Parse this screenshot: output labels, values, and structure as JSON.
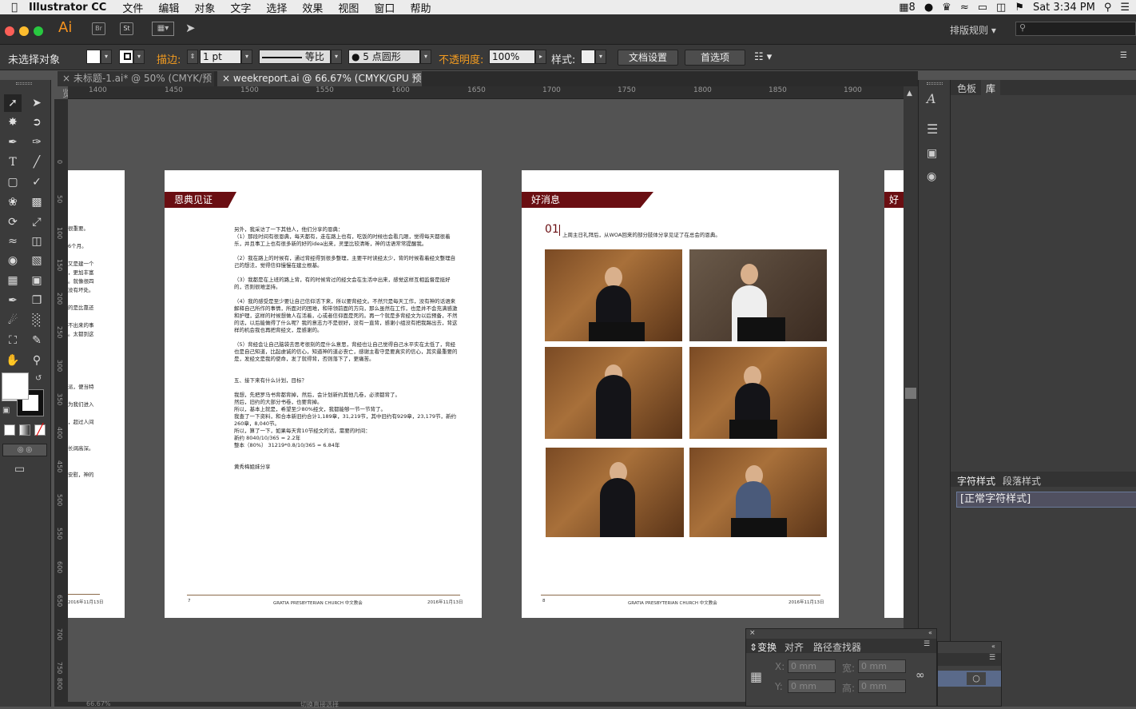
{
  "menubar": {
    "app_name": "Illustrator CC",
    "items": [
      "文件",
      "编辑",
      "对象",
      "文字",
      "选择",
      "效果",
      "视图",
      "窗口",
      "帮助"
    ],
    "status_num": "8",
    "clock": "Sat 3:34 PM"
  },
  "appbar": {
    "logo": "Ai",
    "br": "Br",
    "st": "St",
    "workspace": "排版规则",
    "search_placeholder": ""
  },
  "control": {
    "selection": "未选择对象",
    "stroke_label": "描边:",
    "stroke_value": "1 pt",
    "stroke_profile": "等比",
    "brush": "5 点圆形",
    "opacity_label": "不透明度:",
    "opacity_value": "100%",
    "style_label": "样式:",
    "doc_setup": "文档设置",
    "preferences": "首选项"
  },
  "tabs": [
    {
      "label": "未标题-1.ai* @ 50% (CMYK/预览)"
    },
    {
      "label": "weekreport.ai @ 66.67% (CMYK/GPU 预览)"
    }
  ],
  "ruler": {
    "h": [
      "1400",
      "1450",
      "1500",
      "1550",
      "1600",
      "1650",
      "1700",
      "1750",
      "1800",
      "1850",
      "1900"
    ],
    "v": [
      "0",
      "50",
      "100",
      "150",
      "200",
      "250",
      "300",
      "350",
      "400",
      "450",
      "500",
      "550",
      "600",
      "650",
      "700",
      "750",
      "800",
      "850"
    ]
  },
  "pages": {
    "left_partial": {
      "lines": [
        "很重要。",
        "",
        "6个月。",
        "",
        "又是建一个",
        "，更加丰富",
        "。就像很四",
        "没有坏处。",
        "",
        "的是比靠还",
        "",
        "不出来的事",
        "。太都到这",
        "",
        "",
        "",
        "",
        "",
        "派，便当特",
        "",
        "为我们进入",
        "",
        "，超过人间",
        "",
        "",
        "长阔高深。",
        "",
        "",
        "安慰，神的"
      ],
      "footer": "2016年11月13日"
    },
    "page7": {
      "title": "恩典见证",
      "body": "另外，我采访了一下其他人，他们分享的恩典：\n（1）那段时间有很恩典，每天都有，走在路上也有，吃饭的时候也会看几眼，觉得每天都很着乐，并且事工上也有很多新的好的idea出来，灵里比较清晰，神的话语常常提醒我。\n\n（2）我在路上的时候有，通过背经得到很多整理，主要平时读经太少，背的时候看着经文整理自己的想法，觉得信仰慢慢在建立根基。\n\n（3）我都是在上班的路上背，有的时候背过的经文会在生活中出来，感觉这样互相监督是挺好的，否则很难坚持。\n\n（4）我的感受是至少要让自己信仰活下来，所以要背经文。不然只是每天工作，没有神的话语来解释自己所作的事情，所面对的困难，和带领前面的方向，那么虽然在工作，也是并不会充满感激和护理，这样的时候想做人在活着，心或者信仰面是死的。再一个就是多背经文为以后预备，不然的话，以后能做得了什么呢？我的意志力不是很好，没有一直背，感谢小组没有把我踢出去，背这样的机会我也再把背经文，是感谢的。\n\n（5）背经会让自己脑袋去思考很刻的是什么意思，背经也让自己觉得自己水平实在太低了，背经也是自己知道，比起虔诚的信心，知道神的道必丧亡，感谢主看守是要真实的信心，其实最重要的是，发经文是我的使命，发了就得背，否则落下了，更痛苦。\n\n\n五、接下来有什么计划，目标？\n\n我想，先把罗马书背都背掉，然后，会计划新约其他几卷，必须都背了。\n然后，旧约的大部分书卷，也要背掉。\n所以，基本上就是，希望至少80%经文，我都能够一节一节背了。\n我查了一下资料，和合本新旧约合计1,189章，31,219节，其中旧约有929章，23,179节，新约260章，8,040节。\n所以，算了一下，如果每天背10节经文的话，需要的时间：\n新约 8040/10/365 = 2.2年\n整本（80%） 31219*0.8/10/365 = 6.84年\n\n\n黄秀梅姐妹分享",
      "page_no": "7",
      "church": "GRATIA PRESBYTERIAN CHURCH 中文教会",
      "date": "2016年11月13日"
    },
    "page8": {
      "title": "好消息",
      "num": "01",
      "headline": "上周主日礼拜后，从WOA回来的部分肢体分享见证了在总会的恩典。",
      "page_no": "8",
      "church": "GRATIA PRESBYTERIAN CHURCH 中文教会",
      "date": "2016年11月13日"
    },
    "right_partial": {
      "title": "好"
    }
  },
  "right_panel": {
    "tab1": "色板",
    "tab2": "库",
    "char_style_tab": "字符样式",
    "para_style_tab": "段落样式",
    "normal_style": "[正常字符样式]"
  },
  "transform_panel": {
    "tab1": "变换",
    "tab2": "对齐",
    "tab3": "路径查找器",
    "x_label": "X:",
    "y_label": "Y:",
    "w_label": "宽:",
    "h_label": "高:",
    "x_value": "0 mm",
    "y_value": "0 mm",
    "w_value": "0 mm",
    "h_value": "0 mm"
  },
  "status": {
    "zoom": "66.67%",
    "toggle": "切换直接选择"
  },
  "colors": {
    "accent_band": "#6a0e12",
    "menu_bg": "#ececec",
    "chrome_dark": "#2f2f2f",
    "canvas_bg": "#535353",
    "orange_label": "#f29b20"
  }
}
